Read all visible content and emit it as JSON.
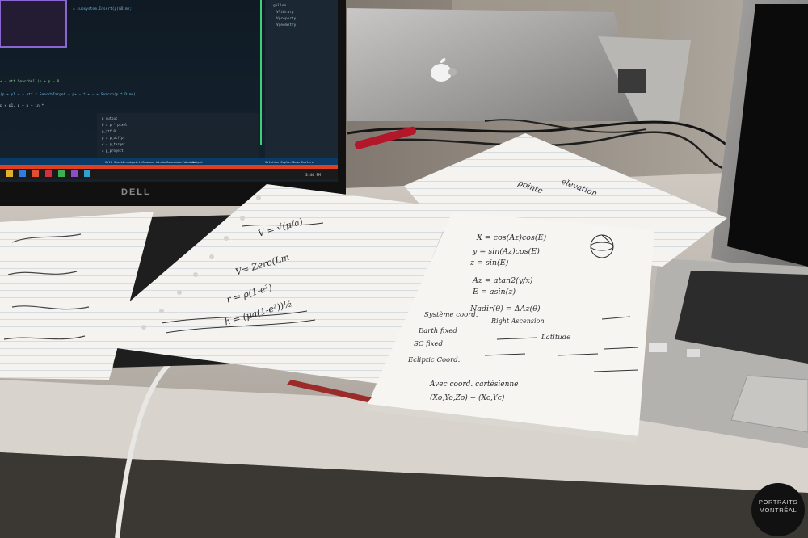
{
  "monitor": {
    "brand": "DELL",
    "code_lines": [
      "= subsystem.Insert(p(mDim);",
      "+ = atf.SearchAll(p + p = 0",
      "(p + p1 + = atf * SearchTarget + p+ = * + = + Search(p * Dims)",
      "p + p1, p + p + in *"
    ],
    "tree_items": [
      "gallen",
      "Vlibrary",
      "Vproperty",
      "Vgeometry"
    ],
    "output_lines": [
      "p_output",
      "b = p * pixel",
      "p_atf 0",
      "p = p_atf(p)",
      "< = p_target",
      "= p_project"
    ],
    "status_tabs": [
      "Call Stack",
      "Breakpoints",
      "Command Window",
      "Immediate Window",
      "Output"
    ],
    "status_right": [
      "Solution Explorer",
      "Team Explorer"
    ],
    "taskbar_time": "3:44 PM"
  },
  "laptop_back": {
    "logo": "apple-logo"
  },
  "notes": {
    "page_a": [
      "V= Zero(Lm",
      "r = ρ(1-e²)",
      "h = (μa(1-e²))½",
      "V = √(μ/a)"
    ],
    "page_b": [
      "X = cos(Az)cos(E)",
      "y = sin(Az)cos(E)",
      "z = sin(E)",
      "Az = atan2(y/x)",
      "E = asin(z)",
      "Nadir(θ) = ΔAz(θ)",
      "Système coord.",
      "Earth fixed",
      "SC fixed",
      "Ecliptic Coord.",
      "Right Ascension",
      "Latitude",
      "Avec coord. cartésienne",
      "(Xo,Yo,Zo) + (Xc,Yc)"
    ],
    "page_c": [
      "elevation",
      "pointe"
    ]
  },
  "watermark": {
    "line1": "PORTRAITS",
    "line2": "MONTRÉAL"
  }
}
